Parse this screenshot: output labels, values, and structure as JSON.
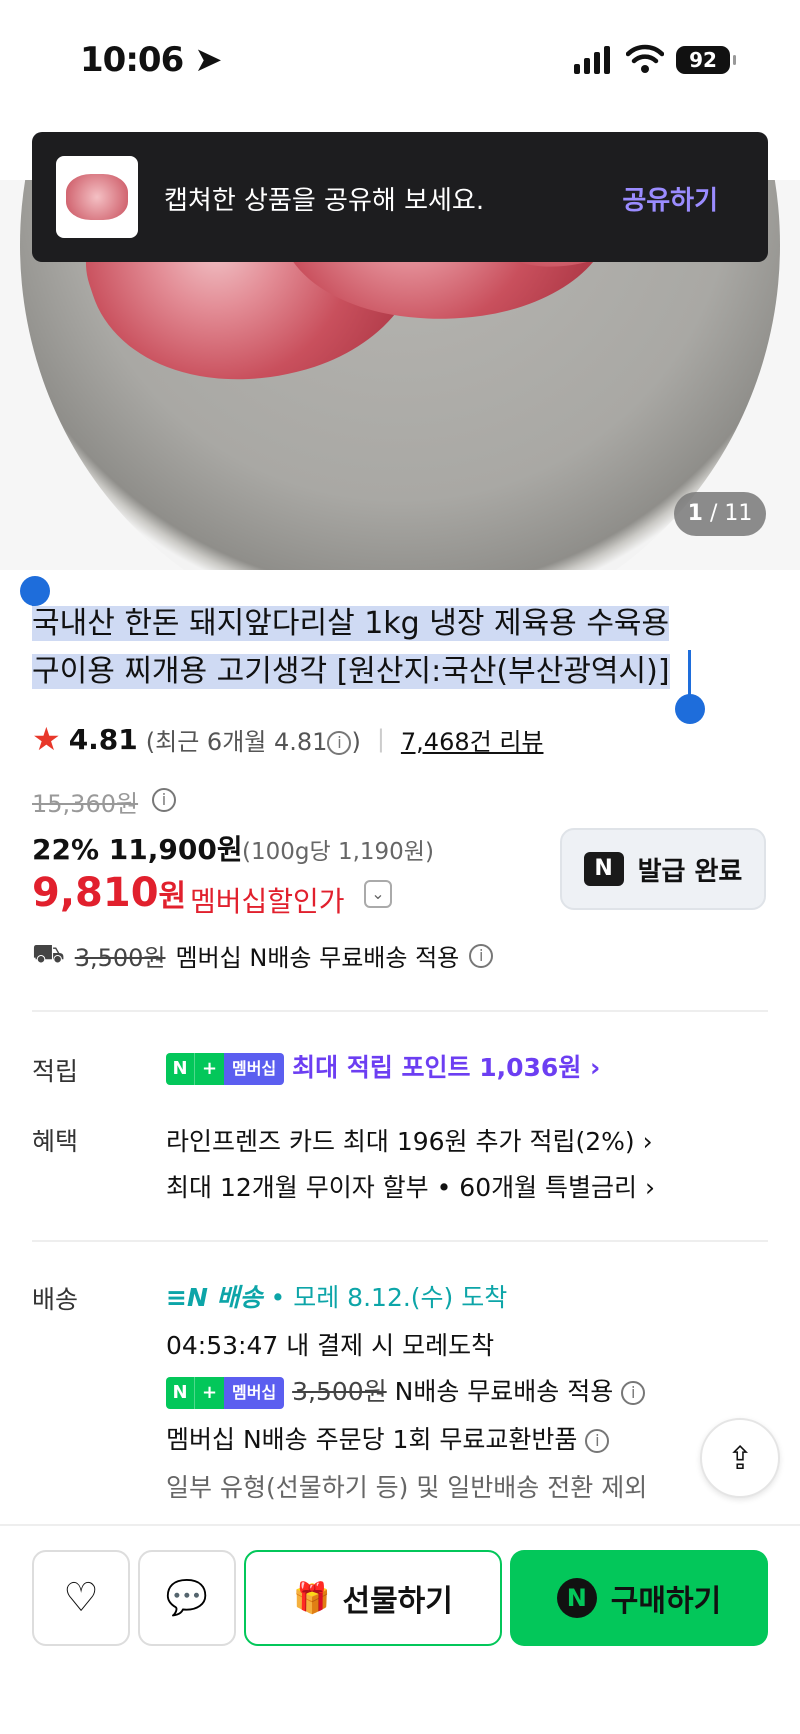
{
  "status_bar": {
    "time": "10:06",
    "battery": "92"
  },
  "toast": {
    "message": "캡쳐한 상품을 공유해 보세요.",
    "action": "공유하기"
  },
  "gallery": {
    "current": "1",
    "total": "/ 11"
  },
  "product": {
    "title_line1": "국내산 한돈 돼지앞다리살 1kg 냉장 제육용 수육용",
    "title_line2": "구이용 찌개용 고기생각 [원산지:국산(부산광역시)]"
  },
  "rating": {
    "star": "★",
    "score": "4.81",
    "recent": "(최근 6개월 4.81",
    "recent_close": ")",
    "reviews": "7,468건 리뷰"
  },
  "price": {
    "original": "15,360원",
    "discount_rate": "22%",
    "sale_price": "11,900원",
    "per_100g": "(100g당 1,190원)",
    "member_price_num": "9,810",
    "member_price_unit": "원",
    "member_label": "멤버십할인가"
  },
  "coupon_button": {
    "badge": "N",
    "label": "발급 완료"
  },
  "shipping_line": {
    "fee": "3,500원",
    "text": "멤버십 N배송 무료배송 적용"
  },
  "points": {
    "label": "적립",
    "badge_n": "N",
    "badge_plus": "+",
    "badge_member": "멤버십",
    "text": "최대 적립 포인트 1,036원 ›"
  },
  "benefits": {
    "label": "혜택",
    "line1": "라인프렌즈 카드 최대 196원 추가 적립(2%) ›",
    "line2": "최대 12개월 무이자 할부 • 60개월 특별금리 ›"
  },
  "delivery": {
    "label": "배송",
    "brand": "배송",
    "arrival": "• 모레 8.12.(수) 도착",
    "deadline": "04:53:47 내 결제 시 모레도착",
    "fee": "3,500원",
    "fee_text": "N배송 무료배송 적용",
    "exchange": "멤버십 N배송 주문당 1회 무료교환반품",
    "exclusion": "일부 유형(선물하기 등) 및 일반배송 전환 제외"
  },
  "bottom_bar": {
    "gift": "선물하기",
    "buy": "구매하기"
  },
  "colors": {
    "accent_green": "#03c75a",
    "price_red": "#e1202d",
    "point_purple": "#6c3ef2",
    "delivery_teal": "#0da5a8"
  }
}
